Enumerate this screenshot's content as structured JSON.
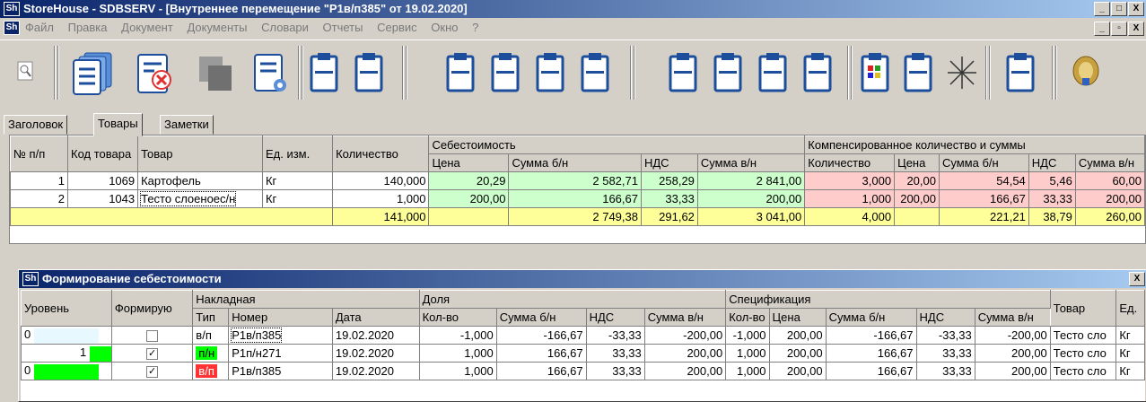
{
  "window": {
    "title": "StoreHouse - SDBSERV - [Внутреннее перемещение \"Р1в/п385\" от 19.02.2020]",
    "app_icon": "Sh",
    "min": "_",
    "max": "□",
    "close": "X",
    "restore": "▫",
    "close_child": "X"
  },
  "menu": [
    "Файл",
    "Правка",
    "Документ",
    "Документы",
    "Словари",
    "Отчеты",
    "Сервис",
    "Окно",
    "?"
  ],
  "toolbar_icons": [
    "preview-icon",
    "documents-icon",
    "delete-document-icon",
    "copy-icon",
    "search-document-icon",
    "clipboard-icon"
  ],
  "tabs": [
    "Заголовок",
    "Товары",
    "Заметки"
  ],
  "main_table": {
    "headers": {
      "num": "№ п/п",
      "code": "Код товара",
      "item": "Товар",
      "unit": "Ед. изм.",
      "qty": "Количество",
      "cost_group": "Себестоимость",
      "price": "Цена",
      "sum_nv": "Сумма б/н",
      "vat": "НДС",
      "sum_v": "Сумма в/н",
      "comp_group": "Компенсированное количество и суммы",
      "c_qty": "Количество",
      "c_price": "Цена",
      "c_sum_nv": "Сумма б/н",
      "c_vat": "НДС",
      "c_sum_v": "Сумма в/н"
    },
    "rows": [
      {
        "num": "1",
        "code": "1069",
        "item": "Картофель",
        "unit": "Кг",
        "qty": "140,000",
        "price": "20,29",
        "sum_nv": "2 582,71",
        "vat": "258,29",
        "sum_v": "2 841,00",
        "c_qty": "3,000",
        "c_price": "20,00",
        "c_sum_nv": "54,54",
        "c_vat": "5,46",
        "c_sum_v": "60,00"
      },
      {
        "num": "2",
        "code": "1043",
        "item": "Тесто слоеноес/н",
        "unit": "Кг",
        "qty": "1,000",
        "price": "200,00",
        "sum_nv": "166,67",
        "vat": "33,33",
        "sum_v": "200,00",
        "c_qty": "1,000",
        "c_price": "200,00",
        "c_sum_nv": "166,67",
        "c_vat": "33,33",
        "c_sum_v": "200,00"
      }
    ],
    "total": {
      "qty": "141,000",
      "sum_nv": "2 749,38",
      "vat": "291,62",
      "sum_v": "3 041,00",
      "c_qty": "4,000",
      "c_sum_nv": "221,21",
      "c_vat": "38,79",
      "c_sum_v": "260,00"
    }
  },
  "sub_window": {
    "title": "Формирование себестоимости",
    "headers": {
      "level": "Уровень",
      "forming": "Формирую",
      "invoice": "Накладная",
      "type": "Тип",
      "number": "Номер",
      "date": "Дата",
      "share": "Доля",
      "s_qty": "Кол-во",
      "s_sum_nv": "Сумма б/н",
      "s_vat": "НДС",
      "s_sum_v": "Сумма в/н",
      "spec": "Спецификация",
      "p_qty": "Кол-во",
      "p_price": "Цена",
      "p_sum_nv": "Сумма б/н",
      "p_vat": "НДС",
      "p_sum_v": "Сумма в/н",
      "item": "Товар",
      "unit": "Ед."
    },
    "rows": [
      {
        "level": "0",
        "checked": "",
        "type": "в/п",
        "number": "Р1в/п385",
        "date": "19.02.2020",
        "s_qty": "-1,000",
        "s_sum_nv": "-166,67",
        "s_vat": "-33,33",
        "s_sum_v": "-200,00",
        "p_qty": "-1,000",
        "p_price": "200,00",
        "p_sum_nv": "-166,67",
        "p_vat": "-33,33",
        "p_sum_v": "-200,00",
        "item": "Тесто сло",
        "unit": "Кг"
      },
      {
        "level": "1",
        "checked": "✓",
        "type": "п/н",
        "number": "Р1п/н271",
        "date": "19.02.2020",
        "s_qty": "1,000",
        "s_sum_nv": "166,67",
        "s_vat": "33,33",
        "s_sum_v": "200,00",
        "p_qty": "1,000",
        "p_price": "200,00",
        "p_sum_nv": "166,67",
        "p_vat": "33,33",
        "p_sum_v": "200,00",
        "item": "Тесто сло",
        "unit": "Кг"
      },
      {
        "level": "0",
        "checked": "✓",
        "type": "в/п",
        "number": "Р1в/п385",
        "date": "19.02.2020",
        "s_qty": "1,000",
        "s_sum_nv": "166,67",
        "s_vat": "33,33",
        "s_sum_v": "200,00",
        "p_qty": "1,000",
        "p_price": "200,00",
        "p_sum_nv": "166,67",
        "p_vat": "33,33",
        "p_sum_v": "200,00",
        "item": "Тесто сло",
        "unit": "Кг"
      }
    ]
  },
  "colors": {
    "cost_bg": "#ccffcc",
    "comp_bg": "#ffcccc",
    "total_bg": "#ffff99",
    "level_green": "#00ff00",
    "tag_red": "#ff3333"
  }
}
